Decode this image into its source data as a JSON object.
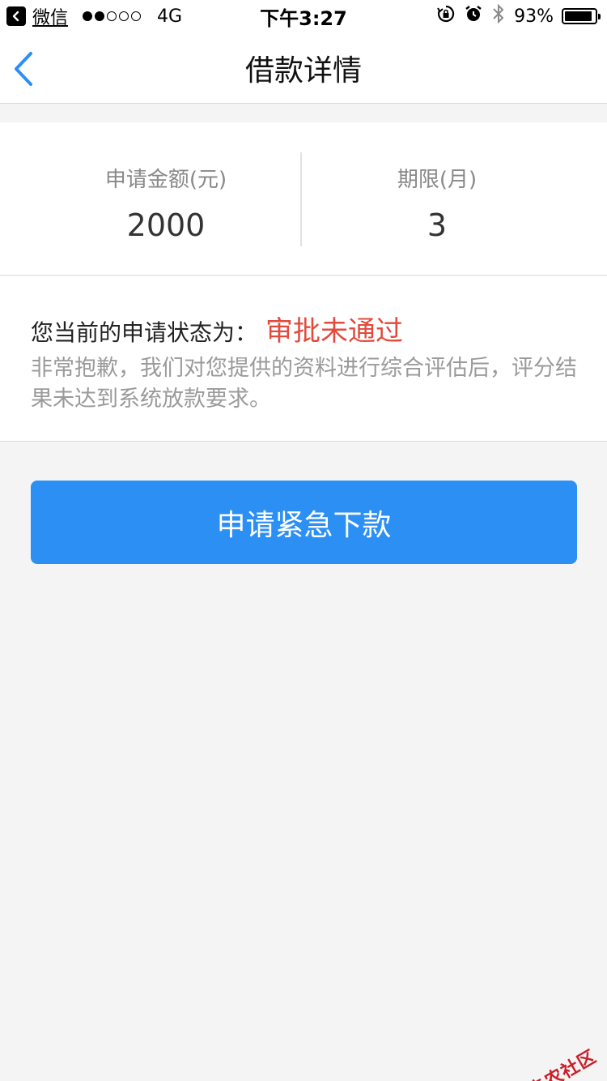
{
  "status_bar": {
    "app_name": "微信",
    "network": "4G",
    "time": "下午3:27",
    "battery_percent": "93%",
    "battery_level": 0.93,
    "signal_filled": 2,
    "signal_total": 5
  },
  "nav": {
    "title": "借款详情",
    "back_icon": "chevron-left-icon"
  },
  "summary": {
    "amount_label": "申请金额(元)",
    "amount_value": "2000",
    "term_label": "期限(月)",
    "term_value": "3"
  },
  "status": {
    "prefix": "您当前的申请状态为：",
    "value": "审批未通过",
    "description": "非常抱歉，我们对您提供的资料进行综合评估后，评分结果未达到系统放款要求。"
  },
  "action": {
    "label": "申请紧急下款"
  },
  "watermark": {
    "text": "卡农社区"
  },
  "colors": {
    "accent_blue": "#2b8ff4",
    "status_red": "#e24a3b",
    "background": "#f4f4f5"
  }
}
